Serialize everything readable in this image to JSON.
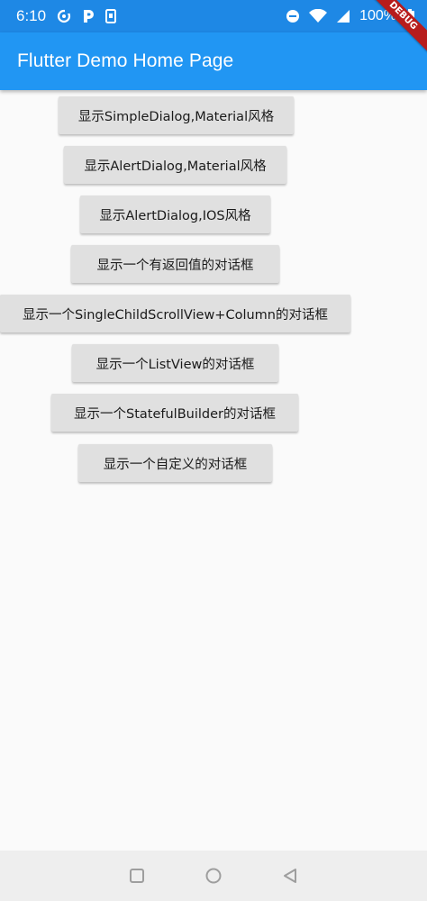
{
  "status_bar": {
    "time": "6:10",
    "battery": "100%"
  },
  "app_bar": {
    "title": "Flutter Demo Home Page"
  },
  "debug_banner": "DEBUG",
  "buttons": [
    "显示SimpleDialog,Material风格",
    "显示AlertDialog,Material风格",
    "显示AlertDialog,IOS风格",
    "显示一个有返回值的对话框",
    "显示一个SingleChildScrollView+Column的对话框",
    "显示一个ListView的对话框",
    "显示一个StatefulBuilder的对话框",
    "显示一个自定义的对话框"
  ],
  "colors": {
    "primary": "#2196f3",
    "status_bar": "#1e88e5",
    "button": "#e0e0e0",
    "background": "#fafafa"
  },
  "icons": {
    "status_left": [
      "sync-icon",
      "p-app-icon",
      "phone-icon"
    ],
    "status_right": [
      "do-not-disturb-icon",
      "wifi-icon",
      "signal-icon",
      "battery-icon"
    ],
    "nav": [
      "recents-icon",
      "home-icon",
      "back-icon"
    ]
  }
}
